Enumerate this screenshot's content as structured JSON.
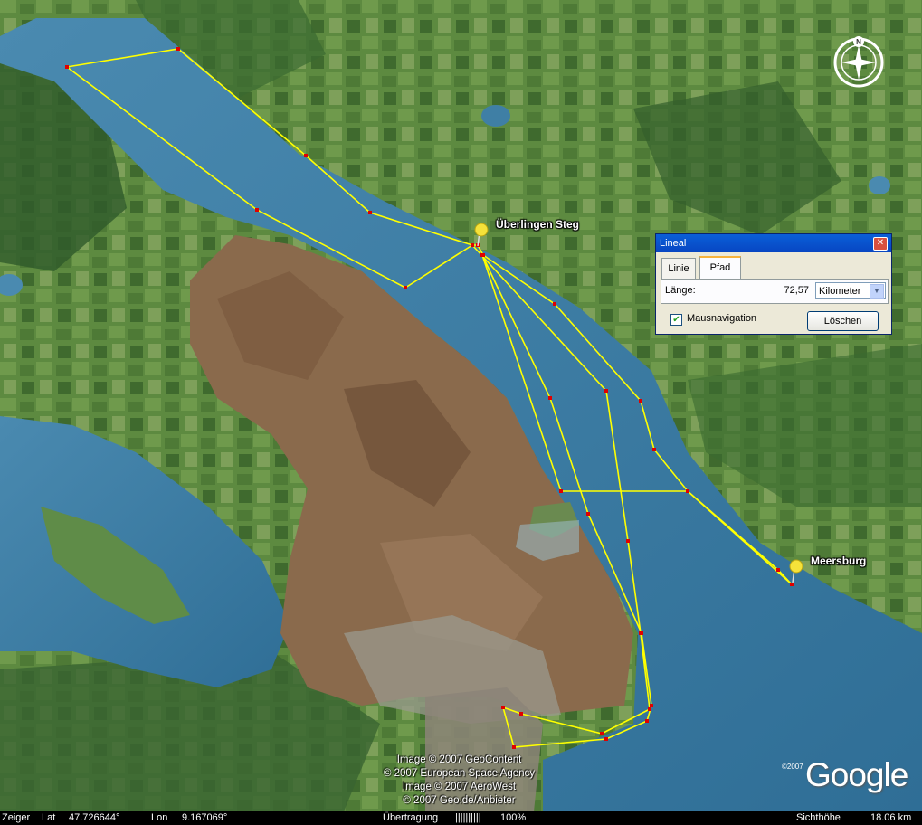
{
  "placemarks": [
    {
      "label": "Überlingen Steg"
    },
    {
      "label": "Meersburg"
    }
  ],
  "credits": [
    "Image © 2007 GeoContent",
    "© 2007 European Space Agency",
    "Image © 2007 AeroWest",
    "© 2007 Geo.de/Anbieter"
  ],
  "logo": {
    "year": "©2007",
    "text": "Google"
  },
  "compass": {
    "north_label": "N"
  },
  "ruler": {
    "title": "Lineal",
    "close_label": "✕",
    "tabs": [
      {
        "label": "Linie",
        "active": false
      },
      {
        "label": "Pfad",
        "active": true
      }
    ],
    "length_label": "Länge:",
    "length_value": "72,57",
    "unit": "Kilometer",
    "mouse_nav_label": "Mausnavigation",
    "mouse_nav_checked": true,
    "delete_label": "Löschen"
  },
  "status": {
    "pointer_label": "Zeiger",
    "lat_label": "Lat",
    "lat_value": "47.726644°",
    "lon_label": "Lon",
    "lon_value": "9.167069°",
    "streaming_label": "Übertragung",
    "streaming_bar": "||||||||||",
    "streaming_value": "100%",
    "eye_alt_label": "Sichthöhe",
    "eye_alt_value": "18.06 km"
  },
  "colors": {
    "path": "#ffff00",
    "vertex": "#e00000",
    "water": "#3a7aa0",
    "land": "#557a3a"
  }
}
